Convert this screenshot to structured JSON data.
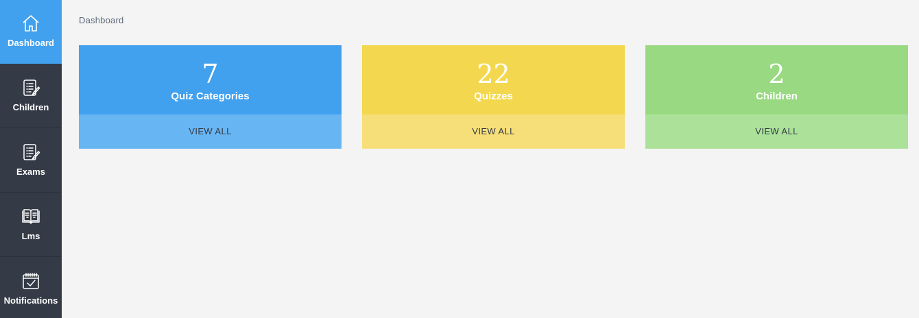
{
  "sidebar": {
    "items": [
      {
        "label": "Dashboard",
        "icon": "home-icon",
        "active": true
      },
      {
        "label": "Children",
        "icon": "clipboard-list-icon",
        "active": false
      },
      {
        "label": "Exams",
        "icon": "clipboard-list-icon",
        "active": false
      },
      {
        "label": "Lms",
        "icon": "open-book-icon",
        "active": false
      },
      {
        "label": "Notifications",
        "icon": "calendar-check-icon",
        "active": false
      }
    ]
  },
  "breadcrumb": {
    "current": "Dashboard"
  },
  "cards": [
    {
      "count": "7",
      "title": "Quiz Categories",
      "action": "VIEW ALL",
      "color": "#42a1ee",
      "footer_color": "#68b5f4"
    },
    {
      "count": "22",
      "title": "Quizzes",
      "action": "VIEW ALL",
      "color": "#f3d84f",
      "footer_color": "#f6df78"
    },
    {
      "count": "2",
      "title": "Children",
      "action": "VIEW ALL",
      "color": "#98d982",
      "footer_color": "#ace199"
    }
  ],
  "colors": {
    "sidebar_bg": "#343b47",
    "active_bg": "#42a1ee",
    "page_bg": "#f4f4f4"
  }
}
